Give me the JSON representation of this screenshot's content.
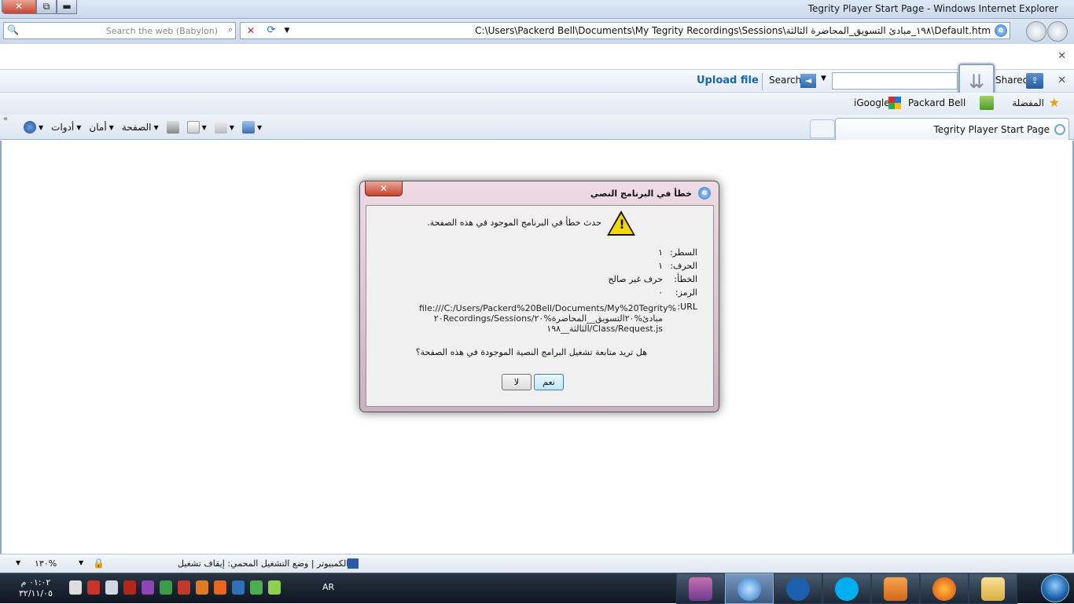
{
  "window": {
    "title": "Tegrity Player Start Page - Windows Internet Explorer",
    "close_label": "✕",
    "maximize_label": "⧉",
    "minimize_label": "▬"
  },
  "addressbar": {
    "search_placeholder": "Search the web (Babylon)",
    "url": "C:\\Users\\Packerd Bell\\Documents\\My Tegrity Recordings\\Sessions\\١٩٨_مبادئ التسويق_المحاضرة الثالثة\\Default.htm"
  },
  "toolbar": {
    "upload_file": "Upload file",
    "search_label": "Search",
    "shared_label": "Shared"
  },
  "favorites_bar": {
    "favorites_label": "المفضلة",
    "items": [
      "Packard Bell",
      "iGoogle"
    ]
  },
  "tabs": [
    {
      "label": "Tegrity Player Start Page"
    }
  ],
  "command_bar": {
    "items": [
      "الصفحة",
      "أمان",
      "أدوات"
    ]
  },
  "dialog": {
    "title": "خطأ في البرنامج النصي",
    "message": "حدث خطأ في البرنامج الموجود في هذه الصفحة.",
    "fields": [
      {
        "label": "السطر:",
        "value": "١"
      },
      {
        "label": "الحرف:",
        "value": "١"
      },
      {
        "label": "الخطأ:",
        "value": "حرف غير صالح"
      },
      {
        "label": "الرمز:",
        "value": "٠"
      },
      {
        "label": "URL:",
        "value": ""
      }
    ],
    "url_lines": [
      "file:///C:/Users/Packerd%20Bell/Documents/My%20Tegrity%",
      "٢٠Recordings/Sessions/مبادئ%٢٠التسويق__المحاضرة%٢٠",
      "الثالثة__١٩٨/Class/Request.js"
    ],
    "question": "هل تريد متابعة تشغيل البرامج النصية الموجودة في هذه الصفحة؟",
    "yes_label": "نعم",
    "no_label": "لا"
  },
  "statusbar": {
    "text": "الكمبيوتر | وضع التشغيل المحمي: إيقاف تشغيل",
    "zoom": "١٣٠%"
  },
  "taskbar": {
    "time": "٠١:٠٢ م",
    "date": "٣٢/١١/٠٥",
    "language": "AR"
  },
  "colors": {
    "accent": "#1565b5",
    "dialog_frame": "#d9c3cf",
    "taskbar": "#1b2838"
  }
}
